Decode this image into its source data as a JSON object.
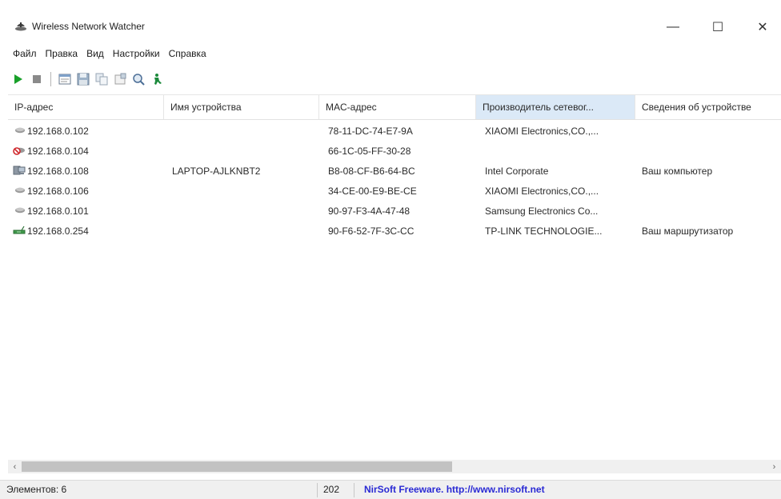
{
  "window": {
    "title": "Wireless Network Watcher",
    "minimize": "—",
    "maximize": "☐",
    "close": "✕"
  },
  "menu": [
    "Файл",
    "Правка",
    "Вид",
    "Настройки",
    "Справка"
  ],
  "toolbar": {
    "icons": [
      "play-icon",
      "stop-icon",
      "html-report-icon",
      "save-icon",
      "copy-icon",
      "properties-icon",
      "advanced-options-icon",
      "exit-icon"
    ],
    "colors": {
      "play": "#19a02a",
      "stop": "#8a8a8a",
      "exit": "#1c8a3c"
    }
  },
  "table": {
    "columns": [
      "IP-адрес",
      "Имя устройства",
      "MAC-адрес",
      "Производитель сетевог...",
      "Сведения об устройстве"
    ],
    "sorted_column": 3,
    "rows": [
      {
        "icon": "device-gray-icon",
        "ip": "192.168.0.102",
        "name": "",
        "mac": "78-11-DC-74-E7-9A",
        "vendor": "XIAOMI Electronics,CO.,...",
        "info": ""
      },
      {
        "icon": "device-offline-icon",
        "ip": "192.168.0.104",
        "name": "",
        "mac": "66-1C-05-FF-30-28",
        "vendor": "",
        "info": ""
      },
      {
        "icon": "computer-icon",
        "ip": "192.168.0.108",
        "name": "LAPTOP-AJLKNBT2",
        "mac": "B8-08-CF-B6-64-BC",
        "vendor": "Intel Corporate",
        "info": "Ваш компьютер"
      },
      {
        "icon": "device-gray-icon",
        "ip": "192.168.0.106",
        "name": "",
        "mac": "34-CE-00-E9-BE-CE",
        "vendor": "XIAOMI Electronics,CO.,...",
        "info": ""
      },
      {
        "icon": "device-gray-icon",
        "ip": "192.168.0.101",
        "name": "",
        "mac": "90-97-F3-4A-47-48",
        "vendor": "Samsung Electronics Co...",
        "info": ""
      },
      {
        "icon": "router-icon",
        "ip": "192.168.0.254",
        "name": "",
        "mac": "90-F6-52-7F-3C-CC",
        "vendor": "TP-LINK TECHNOLOGIE...",
        "info": "Ваш маршрутизатор"
      }
    ]
  },
  "scrollbar": {
    "left_arrow": "‹",
    "right_arrow": "›"
  },
  "status": {
    "count": "Элементов: 6",
    "number": "202",
    "link": "NirSoft Freeware.  http://www.nirsoft.net"
  }
}
